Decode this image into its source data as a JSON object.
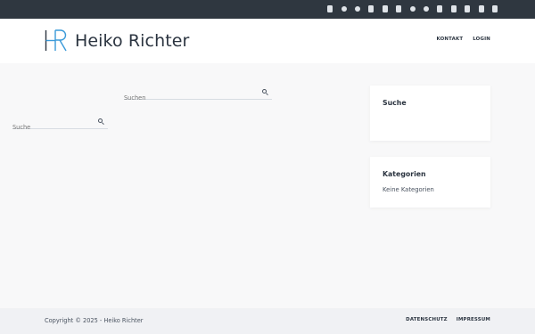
{
  "topbar": {
    "social_icons": [
      "mail-icon",
      "globe-icon",
      "github-icon",
      "facebook-icon",
      "linkedin-icon",
      "paypal-icon",
      "reddit-icon",
      "skype-icon",
      "twitch-icon",
      "pinterest-icon",
      "steam-icon",
      "xing-icon",
      "youtube-icon"
    ]
  },
  "header": {
    "logo_text": "HR",
    "site_title": "Heiko Richter",
    "nav": {
      "contact": "KONTAKT",
      "login": "LOGIN"
    }
  },
  "main": {
    "search": {
      "placeholder": "Suchen"
    }
  },
  "sidebar": {
    "search_widget": {
      "title": "Suche",
      "placeholder": "Suche"
    },
    "categories_widget": {
      "title": "Kategorien",
      "empty_text": "Keine Kategorien"
    }
  },
  "footer": {
    "copyright": "Copyright © 2025 - Heiko Richter",
    "nav": {
      "privacy": "DATENSCHUTZ",
      "imprint": "IMPRESSUM"
    }
  },
  "colors": {
    "topbar": "#2f3740",
    "accent": "#3a9ad9",
    "background": "#f8f8f9"
  }
}
